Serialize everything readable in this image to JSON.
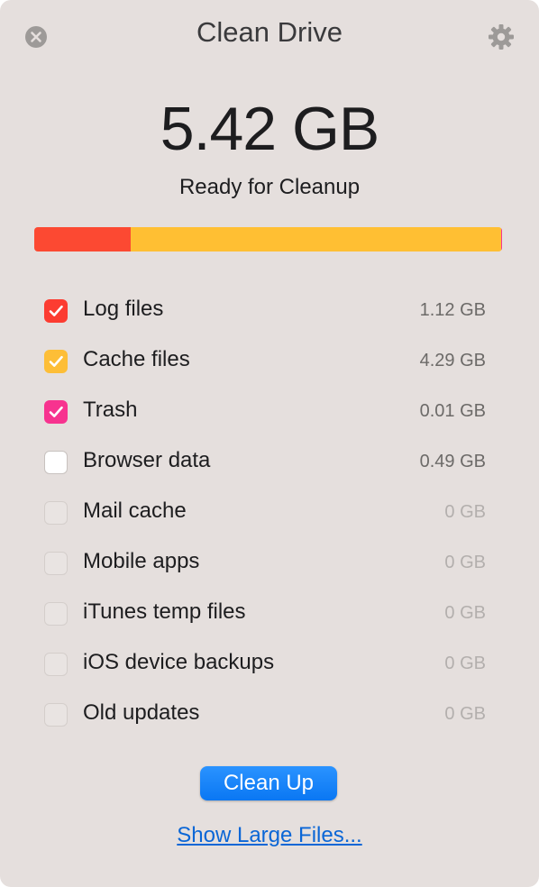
{
  "window": {
    "title": "Clean Drive"
  },
  "summary": {
    "size": "5.42 GB",
    "status": "Ready for Cleanup"
  },
  "usage_bar": {
    "segments": [
      {
        "name": "Log files",
        "gb": 1.12,
        "color": "#fc4932"
      },
      {
        "name": "Cache files",
        "gb": 4.29,
        "color": "#ffbf33"
      },
      {
        "name": "Trash",
        "gb": 0.01,
        "color": "#f7378c"
      }
    ],
    "remaining_color": "#ffffff"
  },
  "items": [
    {
      "label": "Log files",
      "value": "1.12 GB",
      "checked": true,
      "enabled": true,
      "color": "#fc3c31"
    },
    {
      "label": "Cache files",
      "value": "4.29 GB",
      "checked": true,
      "enabled": true,
      "color": "#fdbe37"
    },
    {
      "label": "Trash",
      "value": "0.01 GB",
      "checked": true,
      "enabled": true,
      "color": "#f7338f"
    },
    {
      "label": "Browser data",
      "value": "0.49 GB",
      "checked": false,
      "enabled": true,
      "color": ""
    },
    {
      "label": "Mail cache",
      "value": "0 GB",
      "checked": false,
      "enabled": false,
      "color": ""
    },
    {
      "label": "Mobile apps",
      "value": "0 GB",
      "checked": false,
      "enabled": false,
      "color": ""
    },
    {
      "label": "iTunes temp files",
      "value": "0 GB",
      "checked": false,
      "enabled": false,
      "color": ""
    },
    {
      "label": "iOS device backups",
      "value": "0 GB",
      "checked": false,
      "enabled": false,
      "color": ""
    },
    {
      "label": "Old updates",
      "value": "0 GB",
      "checked": false,
      "enabled": false,
      "color": ""
    }
  ],
  "actions": {
    "clean_label": "Clean Up",
    "large_files_label": "Show Large Files..."
  },
  "icons": {
    "close": "close-icon",
    "settings": "gear-icon",
    "check": "checkmark-icon"
  }
}
